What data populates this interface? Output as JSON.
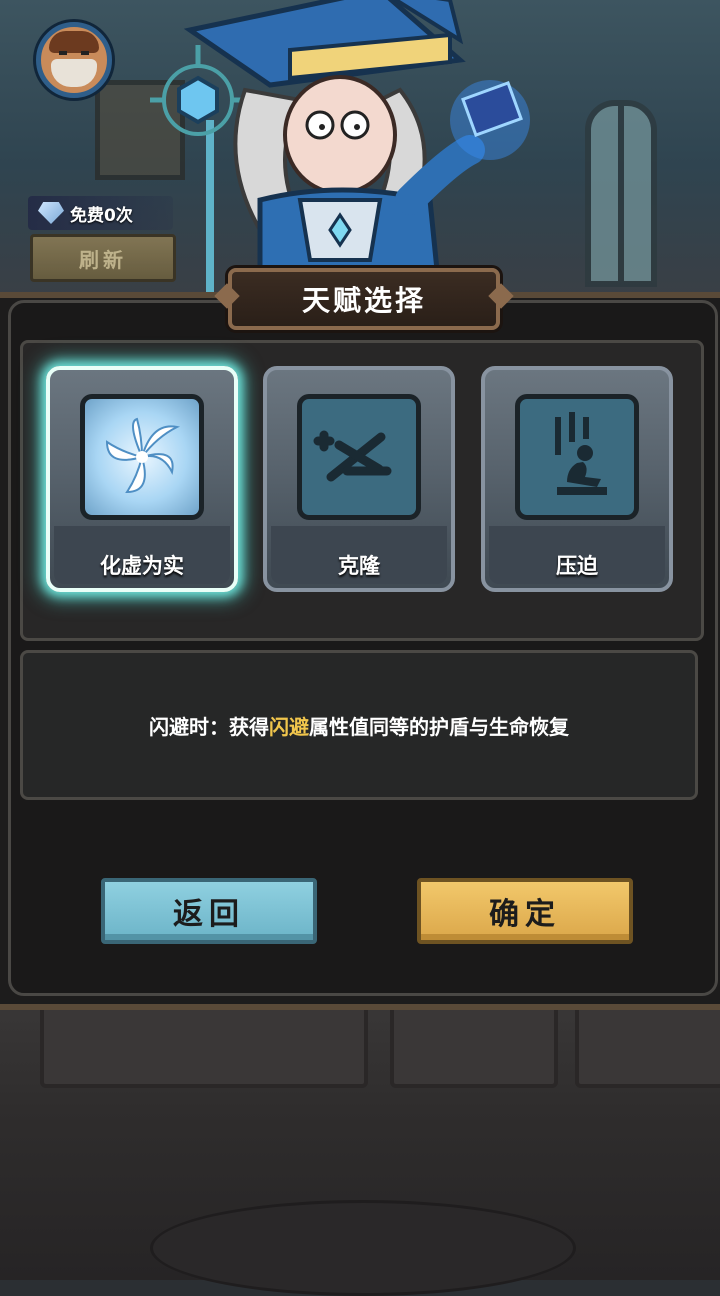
{
  "header": {
    "free_refresh_text": "免费0次",
    "refresh_label": "刷新"
  },
  "panel": {
    "title": "天赋选择"
  },
  "talents": [
    {
      "name": "化虚为实",
      "icon": "swirl-icon",
      "selected": true
    },
    {
      "name": "克隆",
      "icon": "dna-icon",
      "selected": false
    },
    {
      "name": "压迫",
      "icon": "kneeling-figure-icon",
      "selected": false
    }
  ],
  "description": {
    "prefix": "闪避时：获得",
    "highlight": "闪避",
    "suffix": "属性值同等的护盾与生命恢复"
  },
  "buttons": {
    "back_label": "返回",
    "confirm_label": "确定"
  },
  "colors": {
    "highlight": "#f1c64c",
    "back_button": "#8fd0e0",
    "confirm_button": "#f2c86b",
    "selection_glow": "#6fe1d8"
  }
}
